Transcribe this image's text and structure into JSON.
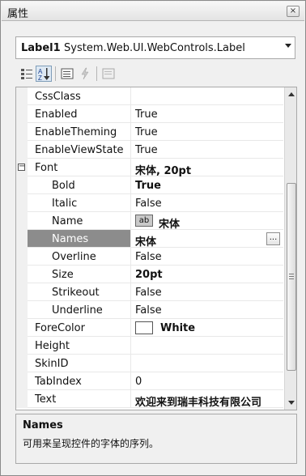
{
  "window": {
    "title": "属性",
    "close_glyph": "×"
  },
  "selector": {
    "object_name": "Label1",
    "object_type": "System.Web.UI.WebControls.Label"
  },
  "toolbar": {
    "buttons": [
      {
        "icon": "categorized-icon",
        "active": false
      },
      {
        "icon": "alphabetical-sort-icon",
        "active": true
      },
      {
        "icon": "properties-icon",
        "active": false
      },
      {
        "icon": "events-lightning-icon",
        "active": false
      },
      {
        "icon": "property-pages-icon",
        "active": false
      }
    ]
  },
  "properties": [
    {
      "name": "CssClass",
      "value": ""
    },
    {
      "name": "Enabled",
      "value": "True"
    },
    {
      "name": "EnableTheming",
      "value": "True"
    },
    {
      "name": "EnableViewState",
      "value": "True"
    },
    {
      "name": "Font",
      "value": "宋体, 20pt",
      "expander": "⊟"
    },
    {
      "name": "Bold",
      "value": "True"
    },
    {
      "name": "Italic",
      "value": "False"
    },
    {
      "name": "Name",
      "value": "宋体",
      "sample": "ab"
    },
    {
      "name": "Names",
      "value": "宋体",
      "button": "..."
    },
    {
      "name": "Overline",
      "value": "False"
    },
    {
      "name": "Size",
      "value": "20pt"
    },
    {
      "name": "Strikeout",
      "value": "False"
    },
    {
      "name": "Underline",
      "value": "False"
    },
    {
      "name": "ForeColor",
      "value": "White",
      "swatch": "#ffffff"
    },
    {
      "name": "Height",
      "value": ""
    },
    {
      "name": "SkinID",
      "value": ""
    },
    {
      "name": "TabIndex",
      "value": "0"
    },
    {
      "name": "Text",
      "value": "欢迎来到瑞丰科技有限公司"
    }
  ],
  "selected_property": "Names",
  "description": {
    "title": "Names",
    "text": "可用来呈现控件的字体的序列。"
  },
  "colors": {
    "selection": "#8c8c8c",
    "panel": "#f0f0f0",
    "border": "#a9a9a9"
  }
}
